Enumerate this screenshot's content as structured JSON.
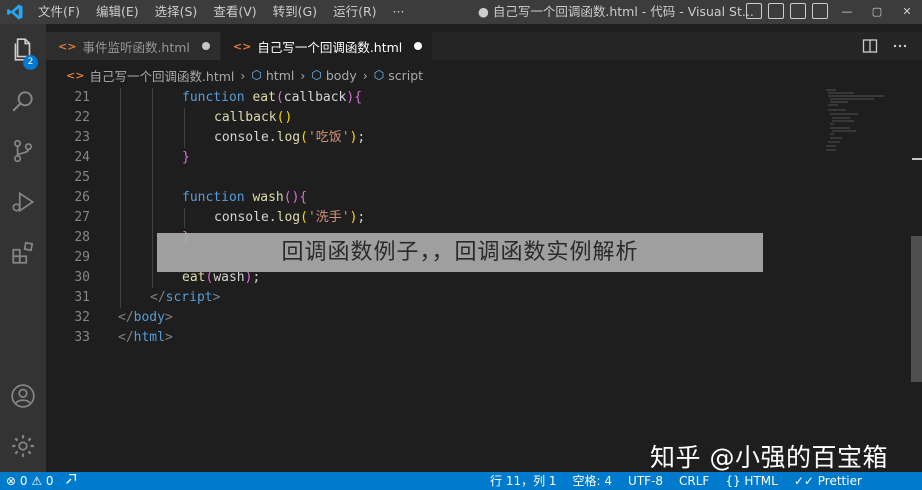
{
  "titlebar": {
    "menu": [
      "文件(F)",
      "编辑(E)",
      "选择(S)",
      "查看(V)",
      "转到(G)",
      "运行(R)",
      "···"
    ],
    "title": "● 自己写一个回调函数.html - 代码 - Visual St...",
    "controls": [
      "—",
      "▢",
      "✕"
    ]
  },
  "activity": {
    "explorer_badge": "2"
  },
  "tabs": [
    {
      "label": "事件监听函数.html",
      "icon": "<>"
    },
    {
      "label": "自己写一个回调函数.html",
      "icon": "<>"
    }
  ],
  "breadcrumb": {
    "file_icon": "<>",
    "items": [
      "自己写一个回调函数.html",
      "html",
      "body",
      "script"
    ]
  },
  "editor": {
    "lines": [
      {
        "num": "21",
        "tokens": [
          [
            "kw",
            "function "
          ],
          [
            "fn",
            "eat"
          ],
          [
            "par",
            "("
          ],
          [
            "pl",
            "callback"
          ],
          [
            "par",
            ")"
          ],
          [
            "par",
            "{"
          ]
        ],
        "indent": 64
      },
      {
        "num": "22",
        "tokens": [
          [
            "fn",
            "callback"
          ],
          [
            "par2",
            "()"
          ]
        ],
        "indent": 96
      },
      {
        "num": "23",
        "tokens": [
          [
            "pl",
            "console."
          ],
          [
            "fn",
            "log"
          ],
          [
            "par2",
            "("
          ],
          [
            "str",
            "'吃饭'"
          ],
          [
            "par2",
            ")"
          ],
          [
            "pl",
            ";"
          ]
        ],
        "indent": 96
      },
      {
        "num": "24",
        "tokens": [
          [
            "par",
            "}"
          ]
        ],
        "indent": 64
      },
      {
        "num": "25",
        "tokens": [],
        "indent": 64
      },
      {
        "num": "26",
        "tokens": [
          [
            "kw",
            "function "
          ],
          [
            "fn",
            "wash"
          ],
          [
            "par",
            "()"
          ],
          [
            "par",
            "{"
          ]
        ],
        "indent": 64
      },
      {
        "num": "27",
        "tokens": [
          [
            "pl",
            "console."
          ],
          [
            "fn",
            "log"
          ],
          [
            "par2",
            "("
          ],
          [
            "str",
            "'洗手'"
          ],
          [
            "par2",
            ")"
          ],
          [
            "pl",
            ";"
          ]
        ],
        "indent": 96
      },
      {
        "num": "28",
        "tokens": [
          [
            "par",
            "}"
          ]
        ],
        "indent": 64
      },
      {
        "num": "29",
        "tokens": [],
        "indent": 64
      },
      {
        "num": "30",
        "tokens": [
          [
            "fn",
            "eat"
          ],
          [
            "par",
            "("
          ],
          [
            "pl",
            "wash"
          ],
          [
            "par",
            ")"
          ],
          [
            "pl",
            ";"
          ]
        ],
        "indent": 64
      },
      {
        "num": "31",
        "tokens": [
          [
            "tagc",
            "</"
          ],
          [
            "tagn",
            "script"
          ],
          [
            "tagc",
            ">"
          ]
        ],
        "indent": 32
      },
      {
        "num": "32",
        "tokens": [
          [
            "tagc",
            "</"
          ],
          [
            "tagn",
            "body"
          ],
          [
            "tagc",
            ">"
          ]
        ],
        "indent": 0
      },
      {
        "num": "33",
        "tokens": [
          [
            "tagc",
            "</"
          ],
          [
            "tagn",
            "html"
          ],
          [
            "tagc",
            ">"
          ]
        ],
        "indent": 0
      }
    ]
  },
  "overlay": {
    "caption": "回调函数例子，，回调函数实例解析",
    "watermark": "知乎 @小强的百宝箱"
  },
  "statusbar": {
    "errors": "⊗ 0 ⚠ 0",
    "position": "行 11，列 1",
    "spaces": "空格: 4",
    "encoding": "UTF-8",
    "eol": "CRLF",
    "language": "{} HTML",
    "formatter": "✓✓ Prettier"
  },
  "colors": {
    "accent": "#007acc",
    "keyword": "#569cd6",
    "function": "#dcdcaa",
    "string": "#ce9178",
    "bracket1": "#da70d6",
    "bracket2": "#ffd700"
  }
}
